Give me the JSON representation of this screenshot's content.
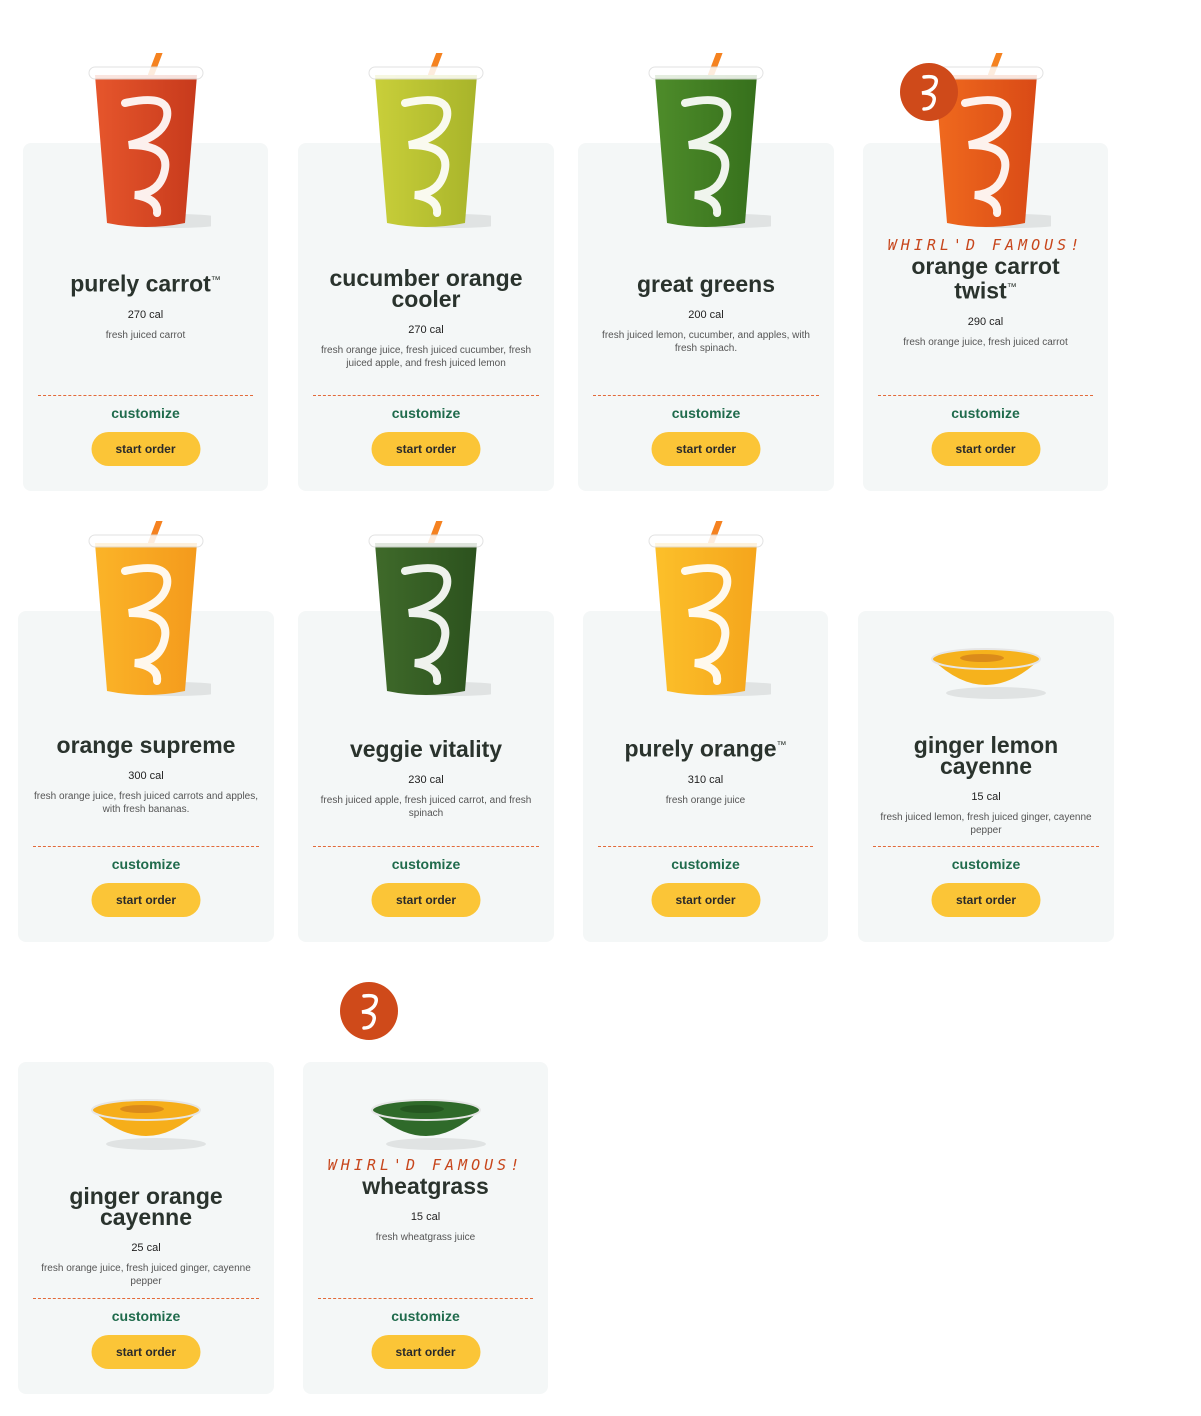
{
  "products": [
    {
      "name": "purely carrot",
      "tm": "™",
      "famous": "",
      "cal": "270 cal",
      "desc": "fresh juiced carrot",
      "customize": "customize",
      "order": "start order",
      "drink": "cup",
      "color": "#e6562c",
      "color2": "#c73a1c"
    },
    {
      "name": "cucumber orange cooler",
      "tm": "",
      "famous": "",
      "cal": "270 cal",
      "desc": "fresh orange juice, fresh juiced cucumber, fresh juiced apple, and fresh juiced lemon",
      "customize": "customize",
      "order": "start order",
      "drink": "cup",
      "color": "#c9cf3a",
      "color2": "#a8b42a"
    },
    {
      "name": "great greens",
      "tm": "",
      "famous": "",
      "cal": "200 cal",
      "desc": "fresh juiced lemon, cucumber, and apples, with fresh spinach.",
      "customize": "customize",
      "order": "start order",
      "drink": "cup",
      "color": "#4e8c2a",
      "color2": "#36701c"
    },
    {
      "name": "orange carrot twist",
      "tm": "™",
      "famous": "WHIRL'D FAMOUS!",
      "cal": "290 cal",
      "desc": "fresh orange juice, fresh juiced carrot",
      "customize": "customize",
      "order": "start order",
      "drink": "cup",
      "color": "#f06a1e",
      "color2": "#d94a16"
    },
    {
      "name": "orange supreme",
      "tm": "",
      "famous": "",
      "cal": "300 cal",
      "desc": "fresh orange juice, fresh juiced carrots and apples, with fresh bananas.",
      "customize": "customize",
      "order": "start order",
      "drink": "cup",
      "color": "#fbb428",
      "color2": "#f49a1c"
    },
    {
      "name": "veggie vitality",
      "tm": "",
      "famous": "",
      "cal": "230 cal",
      "desc": "fresh juiced apple, fresh juiced carrot, and fresh spinach",
      "customize": "customize",
      "order": "start order",
      "drink": "cup",
      "color": "#3f6a2a",
      "color2": "#2c521e"
    },
    {
      "name": "purely orange",
      "tm": "™",
      "famous": "",
      "cal": "310 cal",
      "desc": "fresh orange juice",
      "customize": "customize",
      "order": "start order",
      "drink": "cup",
      "color": "#fcc02a",
      "color2": "#f5a51c"
    },
    {
      "name": "ginger lemon cayenne",
      "tm": "",
      "famous": "",
      "cal": "15 cal",
      "desc": "fresh juiced lemon, fresh juiced ginger, cayenne pepper",
      "customize": "customize",
      "order": "start order",
      "drink": "bowl",
      "color": "#f6b21c",
      "color2": "#d07a1a"
    },
    {
      "name": "ginger orange cayenne",
      "tm": "",
      "famous": "",
      "cal": "25 cal",
      "desc": "fresh orange juice, fresh juiced ginger, cayenne pepper",
      "customize": "customize",
      "order": "start order",
      "drink": "bowl",
      "color": "#f6ae1a",
      "color2": "#d07a1a"
    },
    {
      "name": "wheatgrass",
      "tm": "",
      "famous": "WHIRL'D FAMOUS!",
      "cal": "15 cal",
      "desc": "fresh wheatgrass juice",
      "customize": "customize",
      "order": "start order",
      "drink": "bowl",
      "color": "#2f6a2a",
      "color2": "#1f4f1c"
    }
  ]
}
